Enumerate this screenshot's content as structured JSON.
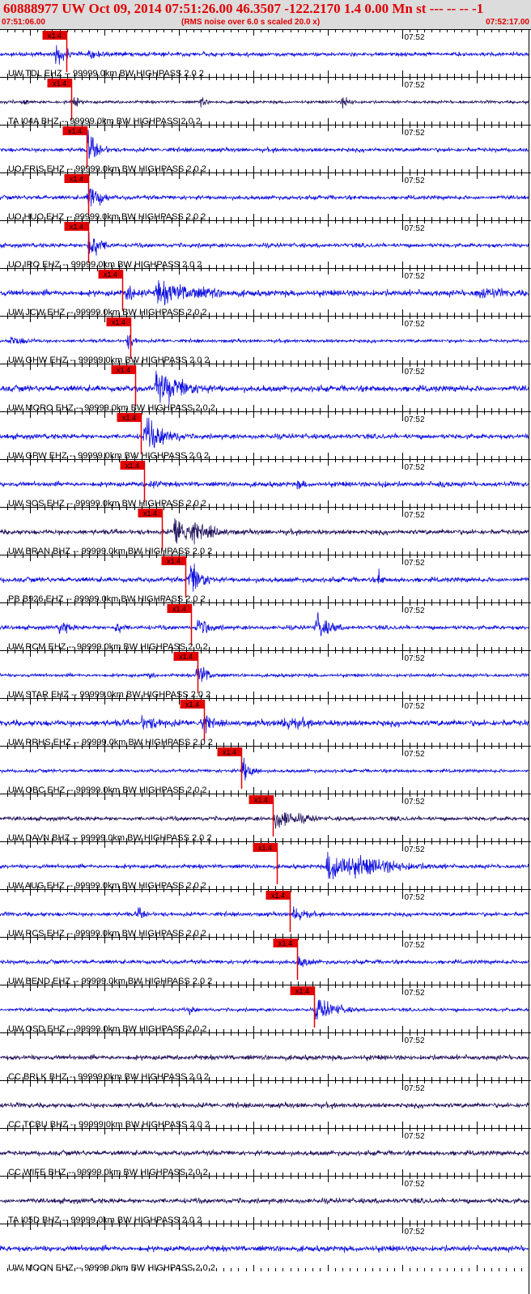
{
  "header": {
    "title": "60888977 UW Oct 09, 2014 07:51:26.00   46.3507 -122.2170  1.4 0.00 Mn st --- -- --  -1",
    "start_time": "07:51:06.00",
    "rms_note": "(RMS noise over 6.0 s scaled 20.0 x)",
    "end_time": "07:52:17.00",
    "background": "#dcdcdc",
    "text_color": "#e00000"
  },
  "chart_data": {
    "type": "line",
    "title": "60888977 UW Oct 09, 2014 07:51:26.00   46.3507 -122.2170  1.4 0.00 Mn st --- -- --  -1",
    "xlim_seconds": [
      0,
      71
    ],
    "minute_tick_label": "07:52",
    "minute_tick_second": 54,
    "grid": true,
    "colors": {
      "ehz": "#1010e0",
      "bhz": "#20105a",
      "pick": "#e00000",
      "axis": "#000000"
    },
    "scale_badge": "x1.4",
    "traces": [
      {
        "label": "UW TDL EHZ -- 99999.0km BW  HIGHPASS  2.0  2",
        "pick_s": 8.9,
        "color": "blue",
        "noise": 0.1,
        "events": [
          {
            "t": 7.5,
            "amp": 0.6,
            "dur": 2
          },
          {
            "t": 12,
            "amp": 0.3,
            "dur": 3
          }
        ]
      },
      {
        "label": "TA I04A BHZ -- 99999.0km BW  HIGHPASS  2.0  2",
        "pick_s": 9.6,
        "color": "dark",
        "noise": 0.07,
        "events": [
          {
            "t": 3,
            "amp": 0.3,
            "dur": 1
          },
          {
            "t": 10,
            "amp": 0.3,
            "dur": 1
          },
          {
            "t": 27,
            "amp": 0.3,
            "dur": 1
          },
          {
            "t": 46,
            "amp": 0.35,
            "dur": 1.5
          }
        ]
      },
      {
        "label": "UO FRIS EHZ -- 99999.0km BW  HIGHPASS  2.0  2",
        "pick_s": 11.6,
        "color": "blue",
        "noise": 0.1,
        "events": [
          {
            "t": 11.8,
            "amp": 1.0,
            "dur": 1.5
          }
        ]
      },
      {
        "label": "UO HUO EHZ -- 99999.0km BW  HIGHPASS  2.0  2",
        "pick_s": 11.8,
        "color": "blue",
        "noise": 0.1,
        "events": [
          {
            "t": 11.9,
            "amp": 1.0,
            "dur": 1.5
          }
        ]
      },
      {
        "label": "UO IRO EHZ -- 99999.0km BW  HIGHPASS  2.0  2",
        "pick_s": 11.8,
        "color": "blue",
        "noise": 0.1,
        "events": [
          {
            "t": 11.9,
            "amp": 1.0,
            "dur": 1.5
          }
        ]
      },
      {
        "label": "UW JCW EHZ -- 99999.0km BW  HIGHPASS  2.0  2",
        "pick_s": 16.4,
        "color": "blue",
        "noise": 0.15,
        "events": [
          {
            "t": 17,
            "amp": 0.6,
            "dur": 2
          },
          {
            "t": 21,
            "amp": 0.7,
            "dur": 8
          },
          {
            "t": 64,
            "amp": 0.4,
            "dur": 6
          }
        ]
      },
      {
        "label": "UW GHW EHZ -- 99999.0km BW  HIGHPASS  2.0  2",
        "pick_s": 17.5,
        "color": "blue",
        "noise": 0.08,
        "events": [
          {
            "t": 1.5,
            "amp": 0.3,
            "dur": 3
          },
          {
            "t": 17.2,
            "amp": 0.5,
            "dur": 1
          }
        ]
      },
      {
        "label": "UW MORO EHZ -- 99999.0km BW  HIGHPASS  2.0  2",
        "pick_s": 18.2,
        "color": "blue",
        "noise": 0.15,
        "events": [
          {
            "t": 21,
            "amp": 0.9,
            "dur": 5
          }
        ]
      },
      {
        "label": "UW GPW EHZ -- 99999.0km BW  HIGHPASS  2.0  2",
        "pick_s": 18.9,
        "color": "blue",
        "noise": 0.12,
        "events": [
          {
            "t": 19.5,
            "amp": 1.0,
            "dur": 3
          }
        ]
      },
      {
        "label": "UW SOS EHZ -- 99999.0km BW  HIGHPASS  2.0  2",
        "pick_s": 19.3,
        "color": "blue",
        "noise": 0.12,
        "events": [
          {
            "t": 20,
            "amp": 0.3,
            "dur": 2
          },
          {
            "t": 40,
            "amp": 0.3,
            "dur": 2
          },
          {
            "t": 51,
            "amp": 0.3,
            "dur": 2
          },
          {
            "t": 59,
            "amp": 0.3,
            "dur": 2
          }
        ]
      },
      {
        "label": "UW BRAN BHZ -- 99999.0km BW  HIGHPASS  2.0  2",
        "pick_s": 21.8,
        "color": "dark",
        "noise": 0.12,
        "events": [
          {
            "t": 23.5,
            "amp": 1.0,
            "dur": 4
          }
        ]
      },
      {
        "label": "PB B926 EHZ -- 99999.0km BW  HIGHPASS  2.0  2",
        "pick_s": 24.9,
        "color": "blue",
        "noise": 0.12,
        "events": [
          {
            "t": 25.5,
            "amp": 1.0,
            "dur": 2
          },
          {
            "t": 51,
            "amp": 0.9,
            "dur": 0.3
          }
        ]
      },
      {
        "label": "UW RCM EHZ -- 99999.0km BW  HIGHPASS  2.0  2",
        "pick_s": 25.7,
        "color": "blue",
        "noise": 0.1,
        "events": [
          {
            "t": 8,
            "amp": 0.4,
            "dur": 2
          },
          {
            "t": 15.5,
            "amp": 0.4,
            "dur": 1.5
          },
          {
            "t": 26.5,
            "amp": 0.6,
            "dur": 2
          },
          {
            "t": 42.5,
            "amp": 0.8,
            "dur": 2
          }
        ]
      },
      {
        "label": "UW STAR EHZ -- 99999.0km BW  HIGHPASS  2.0  2",
        "pick_s": 26.5,
        "color": "blue",
        "noise": 0.08,
        "events": [
          {
            "t": 26.5,
            "amp": 0.8,
            "dur": 1.5
          },
          {
            "t": 20,
            "amp": 0.3,
            "dur": 1
          }
        ]
      },
      {
        "label": "UW RRHS EHZ -- 99999.0km BW  HIGHPASS  2.0  2",
        "pick_s": 27.4,
        "color": "blue",
        "noise": 0.15,
        "events": [
          {
            "t": 19,
            "amp": 0.4,
            "dur": 5
          },
          {
            "t": 27,
            "amp": 0.6,
            "dur": 2
          },
          {
            "t": 38,
            "amp": 0.4,
            "dur": 6
          }
        ]
      },
      {
        "label": "UW OBC EHZ -- 99999.0km BW  HIGHPASS  2.0  2",
        "pick_s": 32.4,
        "color": "blue",
        "noise": 0.08,
        "events": [
          {
            "t": 32.5,
            "amp": 0.7,
            "dur": 1.5
          }
        ]
      },
      {
        "label": "UW DAVN BHZ -- 99999.0km BW  HIGHPASS  2.0  2",
        "pick_s": 36.6,
        "color": "dark",
        "noise": 0.1,
        "events": [
          {
            "t": 37,
            "amp": 0.6,
            "dur": 4
          }
        ]
      },
      {
        "label": "UW AUG EHZ -- 99999.0km BW  HIGHPASS  2.0  2",
        "pick_s": 37.2,
        "color": "blue",
        "noise": 0.1,
        "events": [
          {
            "t": 44,
            "amp": 0.9,
            "dur": 8
          }
        ]
      },
      {
        "label": "UW RCS EHZ -- 99999.0km BW  HIGHPASS  2.0  2",
        "pick_s": 38.9,
        "color": "blue",
        "noise": 0.1,
        "events": [
          {
            "t": 18.5,
            "amp": 0.4,
            "dur": 1.5
          },
          {
            "t": 39.5,
            "amp": 0.5,
            "dur": 2
          }
        ]
      },
      {
        "label": "UW BEND EHZ -- 99999.0km BW  HIGHPASS  2.0  2",
        "pick_s": 39.9,
        "color": "blue",
        "noise": 0.1,
        "events": [
          {
            "t": 40,
            "amp": 0.4,
            "dur": 2
          }
        ]
      },
      {
        "label": "UW OSD EHZ -- 99999.0km BW  HIGHPASS  2.0  2",
        "pick_s": 42.2,
        "color": "blue",
        "noise": 0.08,
        "events": [
          {
            "t": 25.5,
            "amp": 0.3,
            "dur": 1
          },
          {
            "t": 42.5,
            "amp": 0.7,
            "dur": 3
          }
        ]
      },
      {
        "label": "CC BRLK BHZ -- 99999.0km BW  HIGHPASS  2.0  2",
        "pick_s": null,
        "color": "dark",
        "noise": 0.12,
        "events": []
      },
      {
        "label": "CC TCBU BHZ -- 99999.0km BW  HIGHPASS  2.0  2",
        "pick_s": null,
        "color": "dark",
        "noise": 0.12,
        "events": []
      },
      {
        "label": "CC WIFE BHZ -- 99999.0km BW  HIGHPASS  2.0  2",
        "pick_s": null,
        "color": "dark",
        "noise": 0.12,
        "events": []
      },
      {
        "label": "TA I05D BHZ -- 99999.0km BW  HIGHPASS  2.0  2",
        "pick_s": null,
        "color": "dark",
        "noise": 0.12,
        "events": []
      },
      {
        "label": "UW MOON EHZ -- 99999.0km BW  HIGHPASS  2.0  2",
        "pick_s": null,
        "color": "blue",
        "noise": 0.14,
        "events": []
      }
    ]
  }
}
